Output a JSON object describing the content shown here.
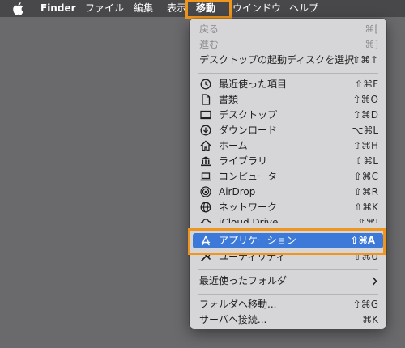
{
  "menubar": {
    "finder": "Finder",
    "items": [
      "ファイル",
      "編集",
      "表示",
      "移動",
      "ウインドウ",
      "ヘルプ"
    ]
  },
  "menu": {
    "back": {
      "label": "戻る",
      "shortcut": "⌘["
    },
    "forward": {
      "label": "進む",
      "shortcut": "⌘]"
    },
    "startup_disk": {
      "label": "デスクトップの起動ディスクを選択",
      "shortcut": "⇧⌘↑"
    },
    "recents": {
      "label": "最近使った項目",
      "shortcut": "⇧⌘F"
    },
    "documents": {
      "label": "書類",
      "shortcut": "⇧⌘O"
    },
    "desktop": {
      "label": "デスクトップ",
      "shortcut": "⇧⌘D"
    },
    "downloads": {
      "label": "ダウンロード",
      "shortcut": "⌥⌘L"
    },
    "home": {
      "label": "ホーム",
      "shortcut": "⇧⌘H"
    },
    "library": {
      "label": "ライブラリ",
      "shortcut": "⇧⌘L"
    },
    "computer": {
      "label": "コンピュータ",
      "shortcut": "⇧⌘C"
    },
    "airdrop": {
      "label": "AirDrop",
      "shortcut": "⇧⌘R"
    },
    "network": {
      "label": "ネットワーク",
      "shortcut": "⇧⌘K"
    },
    "icloud": {
      "label": "iCloud Drive",
      "shortcut": "⇧⌘I"
    },
    "applications": {
      "label": "アプリケーション",
      "shortcut": "⇧⌘A"
    },
    "utilities": {
      "label": "ユーティリティ",
      "shortcut": "⇧⌘U"
    },
    "recent_folders": {
      "label": "最近使ったフォルダ"
    },
    "go_to_folder": {
      "label": "フォルダへ移動...",
      "shortcut": "⇧⌘G"
    },
    "connect_server": {
      "label": "サーバへ接続...",
      "shortcut": "⌘K"
    }
  },
  "colors": {
    "highlight_box": "#f0961e",
    "selection": "#3d79d8"
  }
}
